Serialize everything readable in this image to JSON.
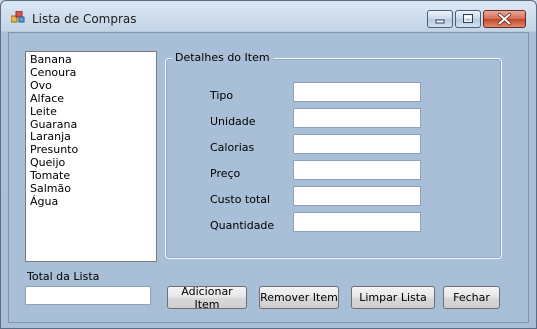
{
  "window": {
    "title": "Lista de Compras"
  },
  "title_bar_buttons": [
    "minimize",
    "maximize",
    "close"
  ],
  "shopping_list": {
    "items": [
      "Banana",
      "Cenoura",
      "Ovo",
      "Alface",
      "Leite",
      "Guarana",
      "Laranja",
      "Presunto",
      "Queijo",
      "Tomate",
      "Salmão",
      "Água"
    ]
  },
  "details": {
    "group_title": "Detalhes do Item",
    "fields": [
      {
        "label": "Tipo",
        "value": ""
      },
      {
        "label": "Unidade",
        "value": ""
      },
      {
        "label": "Calorias",
        "value": ""
      },
      {
        "label": "Preço",
        "value": ""
      },
      {
        "label": "Custo total",
        "value": ""
      },
      {
        "label": "Quantidade",
        "value": ""
      }
    ]
  },
  "total": {
    "label": "Total da Lista",
    "value": ""
  },
  "buttons": {
    "add": "Adicionar Item",
    "remove": "Remover Item",
    "clear": "Limpar Lista",
    "close": "Fechar"
  },
  "colors": {
    "form_background": "#a9bfd8",
    "close_button": "#c4432a"
  }
}
